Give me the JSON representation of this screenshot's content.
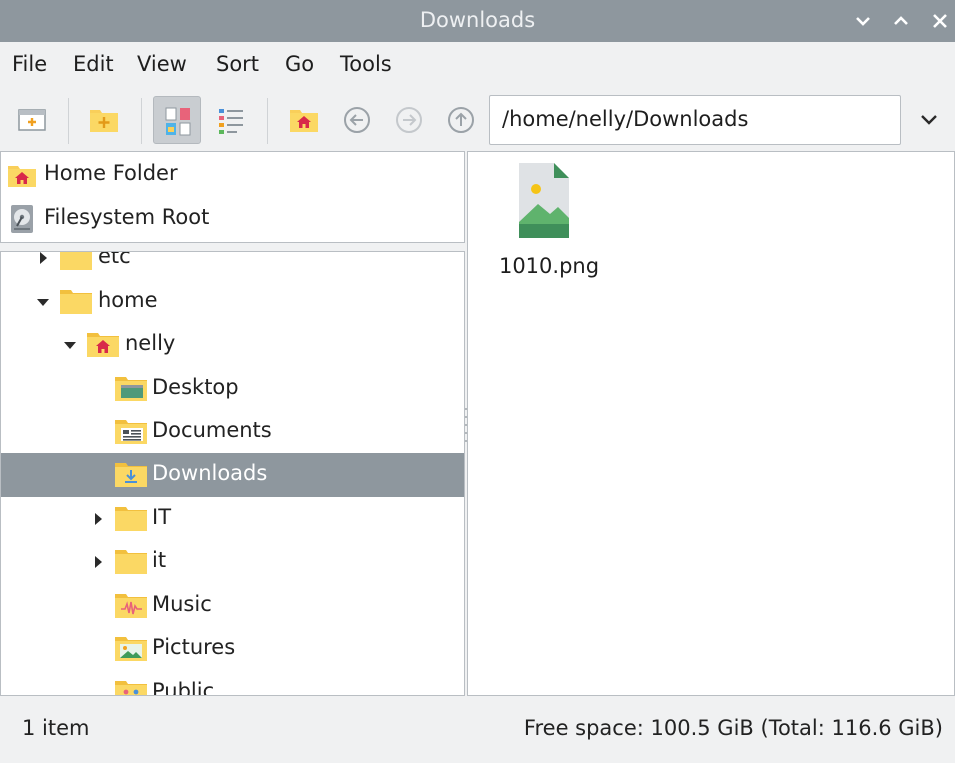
{
  "window": {
    "title": "Downloads"
  },
  "menu": {
    "items": [
      "File",
      "Edit",
      "View",
      "Sort",
      "Go",
      "Tools"
    ]
  },
  "toolbar": {
    "path_value": "/home/nelly/Downloads",
    "buttons": [
      "new-tab-icon",
      "new-folder-icon",
      "icon-view-icon",
      "detailed-view-icon",
      "home-icon",
      "back-icon",
      "forward-icon",
      "up-icon"
    ]
  },
  "places": [
    {
      "label": "Home Folder",
      "icon": "home-folder-icon"
    },
    {
      "label": "Filesystem Root",
      "icon": "drive-icon"
    }
  ],
  "tree": [
    {
      "label": "etc",
      "icon": "folder-icon",
      "expander": "collapsed"
    },
    {
      "label": "home",
      "icon": "folder-icon",
      "expander": "expanded"
    },
    {
      "label": "nelly",
      "icon": "home-folder-icon",
      "expander": "expanded"
    },
    {
      "label": "Desktop",
      "icon": "desktop-folder-icon",
      "expander": "none"
    },
    {
      "label": "Documents",
      "icon": "documents-folder-icon",
      "expander": "none"
    },
    {
      "label": "Downloads",
      "icon": "downloads-folder-icon",
      "expander": "none",
      "selected": true
    },
    {
      "label": "IT",
      "icon": "folder-icon",
      "expander": "collapsed"
    },
    {
      "label": "it",
      "icon": "folder-icon",
      "expander": "collapsed"
    },
    {
      "label": "Music",
      "icon": "music-folder-icon",
      "expander": "none"
    },
    {
      "label": "Pictures",
      "icon": "pictures-folder-icon",
      "expander": "none"
    },
    {
      "label": "Public",
      "icon": "public-folder-icon",
      "expander": "none"
    }
  ],
  "files": [
    {
      "name": "1010.png",
      "icon": "image-file-icon"
    }
  ],
  "status": {
    "items": "1 item",
    "free_space": "Free space: 100.5 GiB (Total: 116.6 GiB)"
  },
  "colors": {
    "titlebar": "#8e979e",
    "selection": "#8e979e",
    "folder": "#f9cf5a",
    "home_badge": "#d8294a"
  }
}
